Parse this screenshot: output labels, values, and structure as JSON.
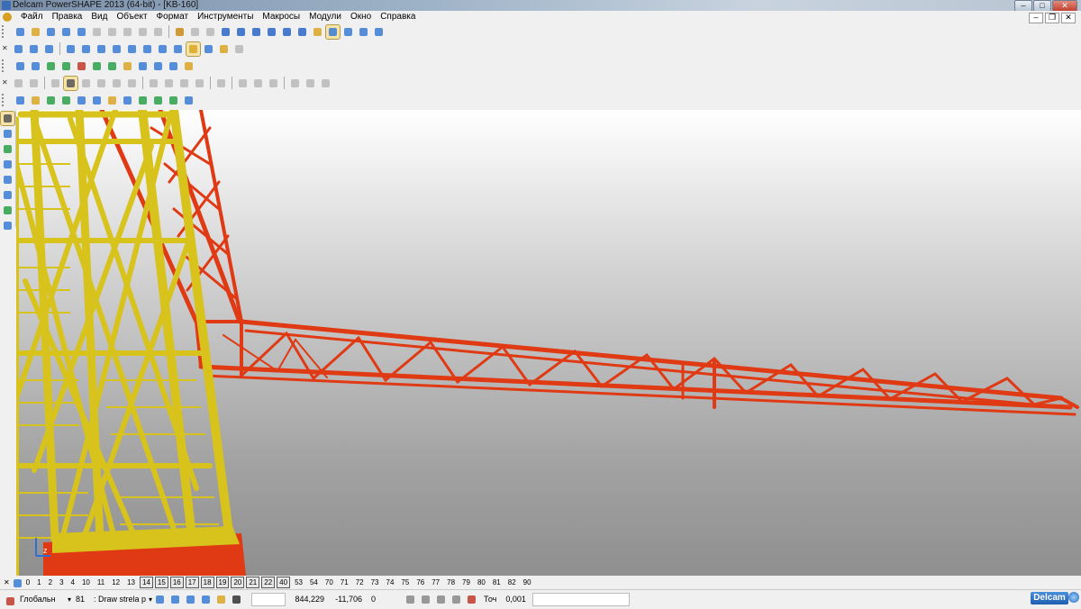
{
  "window": {
    "title": "Delcam PowerSHAPE 2013 (64-bit) - [KB-160]"
  },
  "menu": [
    "Файл",
    "Правка",
    "Вид",
    "Объект",
    "Формат",
    "Инструменты",
    "Макросы",
    "Модули",
    "Окно",
    "Справка"
  ],
  "levels": [
    "0",
    "1",
    "2",
    "3",
    "4",
    "10",
    "11",
    "12",
    "13",
    "14",
    "15",
    "16",
    "17",
    "18",
    "19",
    "20",
    "21",
    "22",
    "40",
    "53",
    "54",
    "70",
    "71",
    "72",
    "73",
    "74",
    "75",
    "76",
    "77",
    "78",
    "79",
    "80",
    "81",
    "82",
    "90"
  ],
  "levels_active": [
    "14",
    "15",
    "16",
    "17",
    "18",
    "19",
    "20",
    "21",
    "22",
    "40"
  ],
  "status": {
    "workplane": "Глобальн",
    "level_number": "81",
    "level_name": ": Draw strela p",
    "x": "844,229",
    "y": "-11,706",
    "z": "0",
    "tolerance_label": "Точ",
    "tolerance": "0,001"
  },
  "brand": "Delcam",
  "colors": {
    "tower": "#d7c31c",
    "boom": "#e03a14",
    "viewport_top": "#ffffff",
    "viewport_bottom": "#8f8f8f"
  }
}
